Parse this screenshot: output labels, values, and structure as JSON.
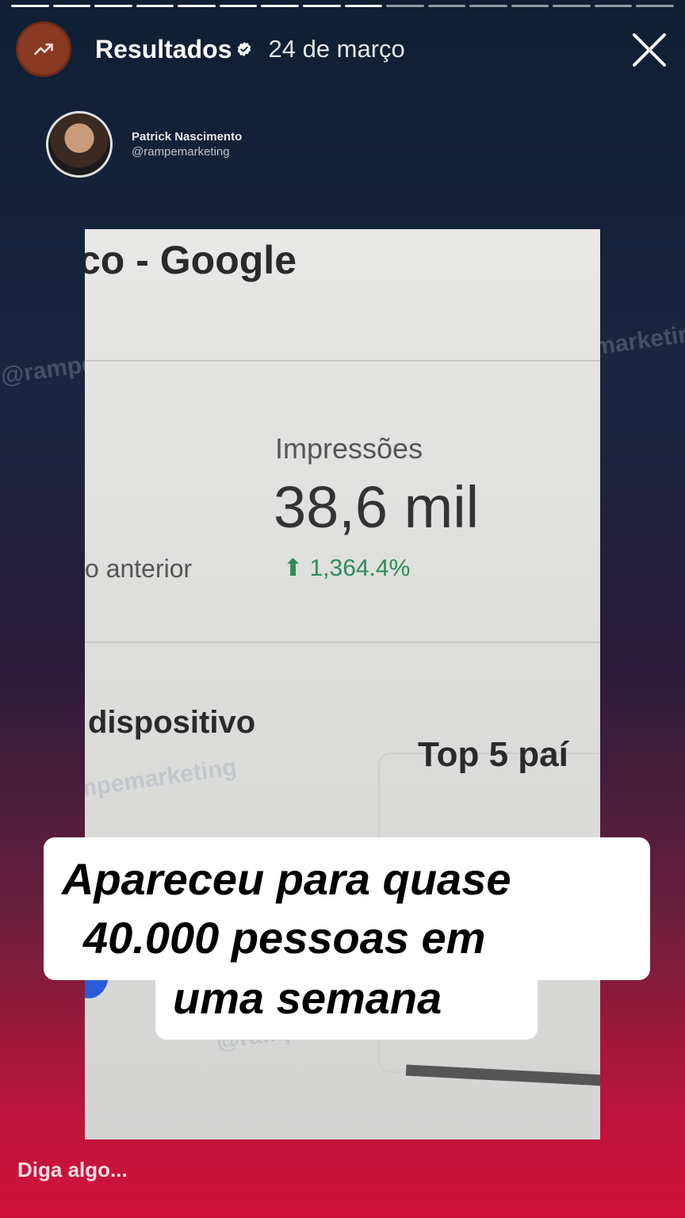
{
  "story": {
    "segments": 16,
    "active_segment": 9,
    "highlight_title": "Resultados",
    "date": "24 de março"
  },
  "profile": {
    "name": "Patrick Nascimento",
    "handle": "@rampemarketing"
  },
  "photo": {
    "heading": "co - Google",
    "impressions_label": "Impressões",
    "impressions_value": "38,6 mil",
    "previous_label": "o anterior",
    "growth": "1,364.4%",
    "device_label": "dispositivo",
    "top5_label": "Top 5 paí",
    "watermark": "@rampemarketing"
  },
  "caption": {
    "line1": "Apareceu para quase",
    "line2": "40.000 pessoas em",
    "line3": "uma semana"
  },
  "reply": {
    "placeholder": "Diga algo..."
  }
}
